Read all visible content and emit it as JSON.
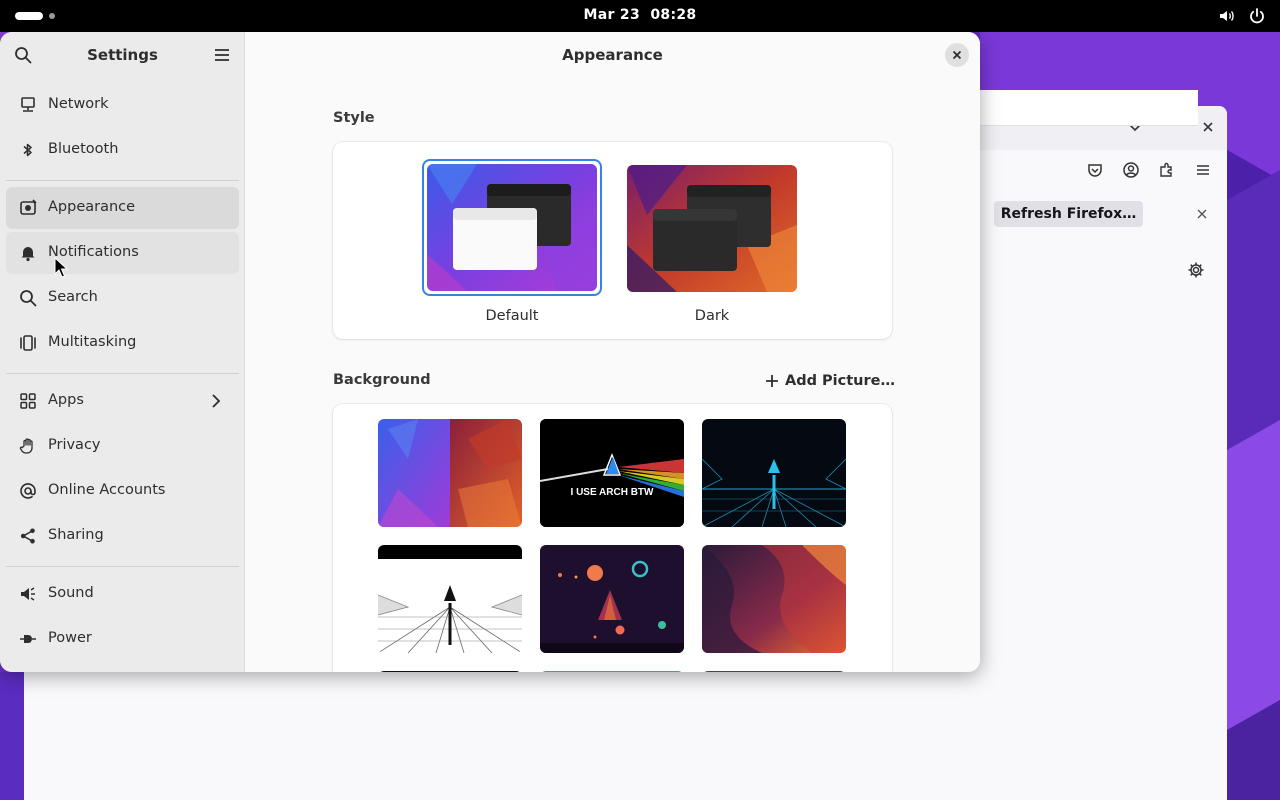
{
  "topbar": {
    "date": "Mar 23",
    "time": "08:28"
  },
  "firefox": {
    "refresh_label": "Refresh Firefox…"
  },
  "settings": {
    "title": "Settings",
    "sidebar": {
      "items": [
        {
          "label": "Network",
          "icon": "network-icon"
        },
        {
          "label": "Bluetooth",
          "icon": "bluetooth-icon"
        },
        {
          "label": "Appearance",
          "icon": "appearance-icon"
        },
        {
          "label": "Notifications",
          "icon": "bell-icon"
        },
        {
          "label": "Search",
          "icon": "search-icon"
        },
        {
          "label": "Multitasking",
          "icon": "multitasking-icon"
        },
        {
          "label": "Apps",
          "icon": "apps-grid-icon"
        },
        {
          "label": "Privacy",
          "icon": "hand-icon"
        },
        {
          "label": "Online Accounts",
          "icon": "at-icon"
        },
        {
          "label": "Sharing",
          "icon": "share-icon"
        },
        {
          "label": "Sound",
          "icon": "speaker-icon"
        },
        {
          "label": "Power",
          "icon": "power-plug-icon"
        }
      ],
      "active": "Appearance"
    },
    "main": {
      "title": "Appearance",
      "style_section": "Style",
      "styles": [
        {
          "label": "Default",
          "selected": true
        },
        {
          "label": "Dark",
          "selected": false
        }
      ],
      "background_section": "Background",
      "add_picture": "Add Picture…",
      "wallpapers": [
        {
          "caption": ""
        },
        {
          "caption": "I USE ARCH BTW"
        },
        {
          "caption": ""
        },
        {
          "caption": ""
        },
        {
          "caption": ""
        },
        {
          "caption": ""
        }
      ]
    }
  },
  "colors": {
    "accent": "#3584e4",
    "sidebar_bg": "#ebebeb",
    "topbar_bg": "#000000"
  }
}
